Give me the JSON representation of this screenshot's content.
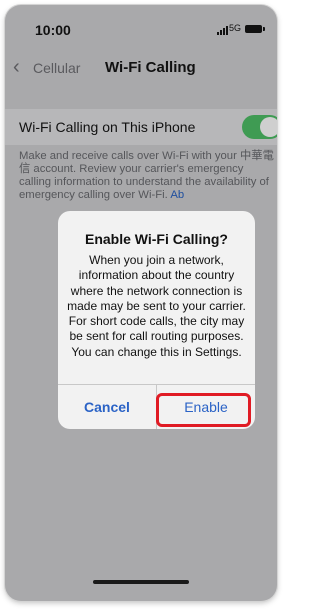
{
  "status_bar": {
    "time": "10:00",
    "network": "5G"
  },
  "nav": {
    "back_label": "Cellular",
    "title": "Wi-Fi Calling"
  },
  "wifi_calling_row": {
    "label": "Wi-Fi Calling on This iPhone",
    "toggle_on": true
  },
  "description": {
    "text": "Make and receive calls over Wi-Fi with your 中華電信 account. Review your carrier's emergency calling information to understand the availability of emergency calling over Wi-Fi.",
    "link": "Ab"
  },
  "alert": {
    "title": "Enable Wi-Fi Calling?",
    "message": "When you join a network, information about the country where the network connection is made may be sent to your carrier. For short code calls, the city may be sent for call routing purposes. You can change this in Settings.",
    "cancel_label": "Cancel",
    "enable_label": "Enable"
  },
  "colors": {
    "accent": "#2b63c6",
    "toggle": "#3f9b53",
    "highlight": "#e01b24"
  }
}
